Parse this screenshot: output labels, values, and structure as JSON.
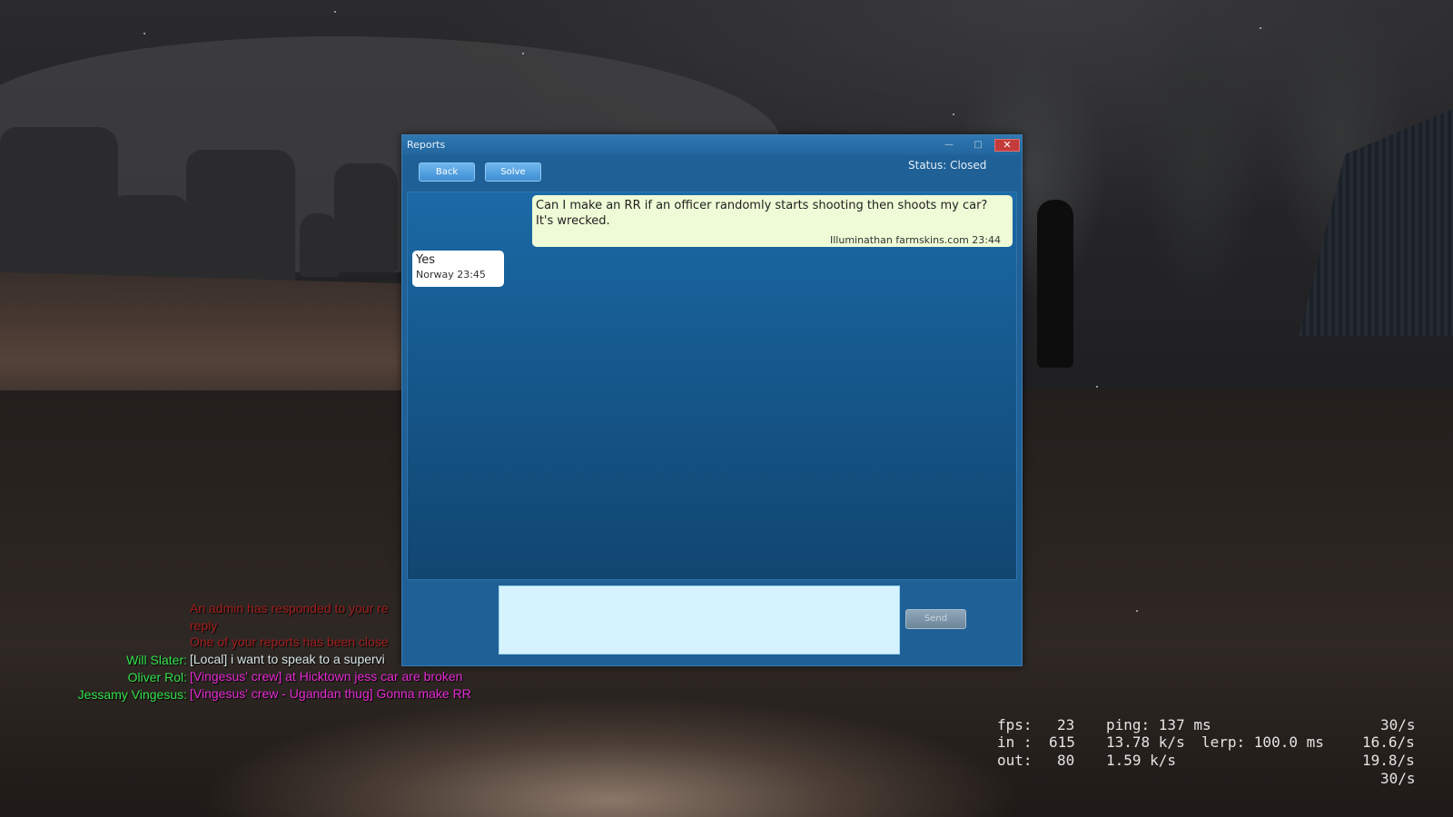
{
  "window": {
    "title": "Reports",
    "minimize_glyph": "—",
    "maximize_glyph": "□",
    "close_glyph": "✕",
    "back_label": "Back",
    "solve_label": "Solve",
    "status": "Status: Closed",
    "send_label": "Send",
    "reply_value": ""
  },
  "messages": [
    {
      "text_line1": "Can I make an RR if an officer randomly starts shooting then shoots my car?",
      "text_line2": "It's wrecked.",
      "meta": "Illuminathan farmskins.com 23:44"
    },
    {
      "text": "Yes",
      "meta": "Norway 23:45"
    }
  ],
  "chat_log": {
    "sys1a": "An admin has responded to your re",
    "sys1b": "reply",
    "sys2": "One of your reports has been close",
    "lines": [
      {
        "name": "Will Slater:",
        "text": "[Local] i want to speak to a supervi"
      },
      {
        "name": "Oliver Rol:",
        "text": "[Vingesus' crew] at Hicktown jess car are broken"
      },
      {
        "name": "Jessamy Vingesus:",
        "text": "[Vingesus' crew - Ugandan thug] Gonna make RR"
      }
    ]
  },
  "netgraph": {
    "fps_label": "fps:",
    "fps": "23",
    "ping": "ping: 137 ms",
    "rate1": "30/s",
    "in_label": "in :",
    "in": "615",
    "in_rate": "13.78 k/s",
    "lerp": "lerp: 100.0 ms",
    "rate2": "16.6/s",
    "out_label": "out:",
    "out": "80",
    "out_rate": "1.59 k/s",
    "rate3": "19.8/s",
    "rate4": "30/s"
  },
  "colors": {
    "window_bg": "#1f6096",
    "close_button": "#c43b3b",
    "player_bubble": "#eefbd6",
    "admin_bubble": "#ffffff",
    "chat_name": "#33e04c",
    "crew_text": "#e52bd2",
    "system_text": "#a11f1f"
  }
}
